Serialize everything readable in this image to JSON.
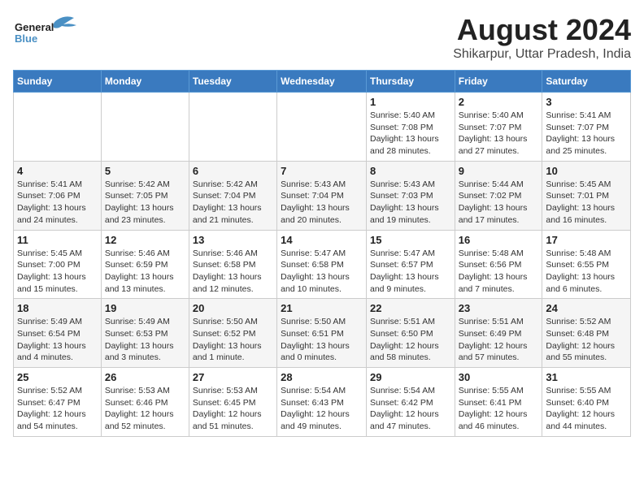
{
  "logo": {
    "text_general": "General",
    "text_blue": "Blue"
  },
  "title": {
    "month_year": "August 2024",
    "location": "Shikarpur, Uttar Pradesh, India"
  },
  "days_of_week": [
    "Sunday",
    "Monday",
    "Tuesday",
    "Wednesday",
    "Thursday",
    "Friday",
    "Saturday"
  ],
  "weeks": [
    [
      {
        "day": "",
        "detail": ""
      },
      {
        "day": "",
        "detail": ""
      },
      {
        "day": "",
        "detail": ""
      },
      {
        "day": "",
        "detail": ""
      },
      {
        "day": "1",
        "detail": "Sunrise: 5:40 AM\nSunset: 7:08 PM\nDaylight: 13 hours and 28 minutes."
      },
      {
        "day": "2",
        "detail": "Sunrise: 5:40 AM\nSunset: 7:07 PM\nDaylight: 13 hours and 27 minutes."
      },
      {
        "day": "3",
        "detail": "Sunrise: 5:41 AM\nSunset: 7:07 PM\nDaylight: 13 hours and 25 minutes."
      }
    ],
    [
      {
        "day": "4",
        "detail": "Sunrise: 5:41 AM\nSunset: 7:06 PM\nDaylight: 13 hours and 24 minutes."
      },
      {
        "day": "5",
        "detail": "Sunrise: 5:42 AM\nSunset: 7:05 PM\nDaylight: 13 hours and 23 minutes."
      },
      {
        "day": "6",
        "detail": "Sunrise: 5:42 AM\nSunset: 7:04 PM\nDaylight: 13 hours and 21 minutes."
      },
      {
        "day": "7",
        "detail": "Sunrise: 5:43 AM\nSunset: 7:04 PM\nDaylight: 13 hours and 20 minutes."
      },
      {
        "day": "8",
        "detail": "Sunrise: 5:43 AM\nSunset: 7:03 PM\nDaylight: 13 hours and 19 minutes."
      },
      {
        "day": "9",
        "detail": "Sunrise: 5:44 AM\nSunset: 7:02 PM\nDaylight: 13 hours and 17 minutes."
      },
      {
        "day": "10",
        "detail": "Sunrise: 5:45 AM\nSunset: 7:01 PM\nDaylight: 13 hours and 16 minutes."
      }
    ],
    [
      {
        "day": "11",
        "detail": "Sunrise: 5:45 AM\nSunset: 7:00 PM\nDaylight: 13 hours and 15 minutes."
      },
      {
        "day": "12",
        "detail": "Sunrise: 5:46 AM\nSunset: 6:59 PM\nDaylight: 13 hours and 13 minutes."
      },
      {
        "day": "13",
        "detail": "Sunrise: 5:46 AM\nSunset: 6:58 PM\nDaylight: 13 hours and 12 minutes."
      },
      {
        "day": "14",
        "detail": "Sunrise: 5:47 AM\nSunset: 6:58 PM\nDaylight: 13 hours and 10 minutes."
      },
      {
        "day": "15",
        "detail": "Sunrise: 5:47 AM\nSunset: 6:57 PM\nDaylight: 13 hours and 9 minutes."
      },
      {
        "day": "16",
        "detail": "Sunrise: 5:48 AM\nSunset: 6:56 PM\nDaylight: 13 hours and 7 minutes."
      },
      {
        "day": "17",
        "detail": "Sunrise: 5:48 AM\nSunset: 6:55 PM\nDaylight: 13 hours and 6 minutes."
      }
    ],
    [
      {
        "day": "18",
        "detail": "Sunrise: 5:49 AM\nSunset: 6:54 PM\nDaylight: 13 hours and 4 minutes."
      },
      {
        "day": "19",
        "detail": "Sunrise: 5:49 AM\nSunset: 6:53 PM\nDaylight: 13 hours and 3 minutes."
      },
      {
        "day": "20",
        "detail": "Sunrise: 5:50 AM\nSunset: 6:52 PM\nDaylight: 13 hours and 1 minute."
      },
      {
        "day": "21",
        "detail": "Sunrise: 5:50 AM\nSunset: 6:51 PM\nDaylight: 13 hours and 0 minutes."
      },
      {
        "day": "22",
        "detail": "Sunrise: 5:51 AM\nSunset: 6:50 PM\nDaylight: 12 hours and 58 minutes."
      },
      {
        "day": "23",
        "detail": "Sunrise: 5:51 AM\nSunset: 6:49 PM\nDaylight: 12 hours and 57 minutes."
      },
      {
        "day": "24",
        "detail": "Sunrise: 5:52 AM\nSunset: 6:48 PM\nDaylight: 12 hours and 55 minutes."
      }
    ],
    [
      {
        "day": "25",
        "detail": "Sunrise: 5:52 AM\nSunset: 6:47 PM\nDaylight: 12 hours and 54 minutes."
      },
      {
        "day": "26",
        "detail": "Sunrise: 5:53 AM\nSunset: 6:46 PM\nDaylight: 12 hours and 52 minutes."
      },
      {
        "day": "27",
        "detail": "Sunrise: 5:53 AM\nSunset: 6:45 PM\nDaylight: 12 hours and 51 minutes."
      },
      {
        "day": "28",
        "detail": "Sunrise: 5:54 AM\nSunset: 6:43 PM\nDaylight: 12 hours and 49 minutes."
      },
      {
        "day": "29",
        "detail": "Sunrise: 5:54 AM\nSunset: 6:42 PM\nDaylight: 12 hours and 47 minutes."
      },
      {
        "day": "30",
        "detail": "Sunrise: 5:55 AM\nSunset: 6:41 PM\nDaylight: 12 hours and 46 minutes."
      },
      {
        "day": "31",
        "detail": "Sunrise: 5:55 AM\nSunset: 6:40 PM\nDaylight: 12 hours and 44 minutes."
      }
    ]
  ]
}
